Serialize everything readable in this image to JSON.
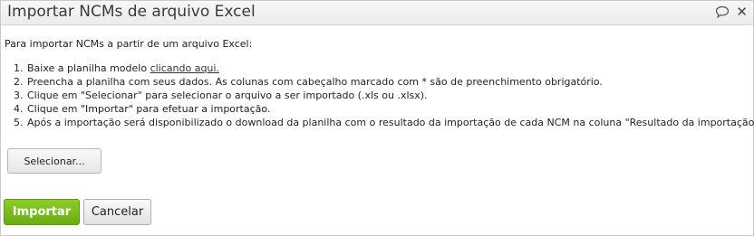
{
  "dialog": {
    "title": "Importar NCMs de arquivo Excel",
    "icons": {
      "help": "speech-bubble-icon",
      "close": "close-icon"
    }
  },
  "content": {
    "intro": "Para importar NCMs a partir de um arquivo Excel:",
    "steps": [
      {
        "text": "Baixe a planilha modelo ",
        "link": "clicando aqui."
      },
      {
        "text": "Preencha a planilha com seus dados. As colunas com cabeçalho marcado com * são de preenchimento obrigatório."
      },
      {
        "text": "Clique em \"Selecionar\" para selecionar o arquivo a ser importado (.xls ou .xlsx)."
      },
      {
        "text": "Clique em \"Importar\" para efetuar a importação."
      },
      {
        "text": "Após a importação será disponibilizado o download da planilha com o resultado da importação de cada NCM na coluna \"Resultado da importação\"."
      }
    ]
  },
  "buttons": {
    "select": "Selecionar...",
    "import": "Importar",
    "cancel": "Cancelar"
  },
  "colors": {
    "primary_button": "#7cbf1e",
    "title_text": "#3a3a3a"
  }
}
